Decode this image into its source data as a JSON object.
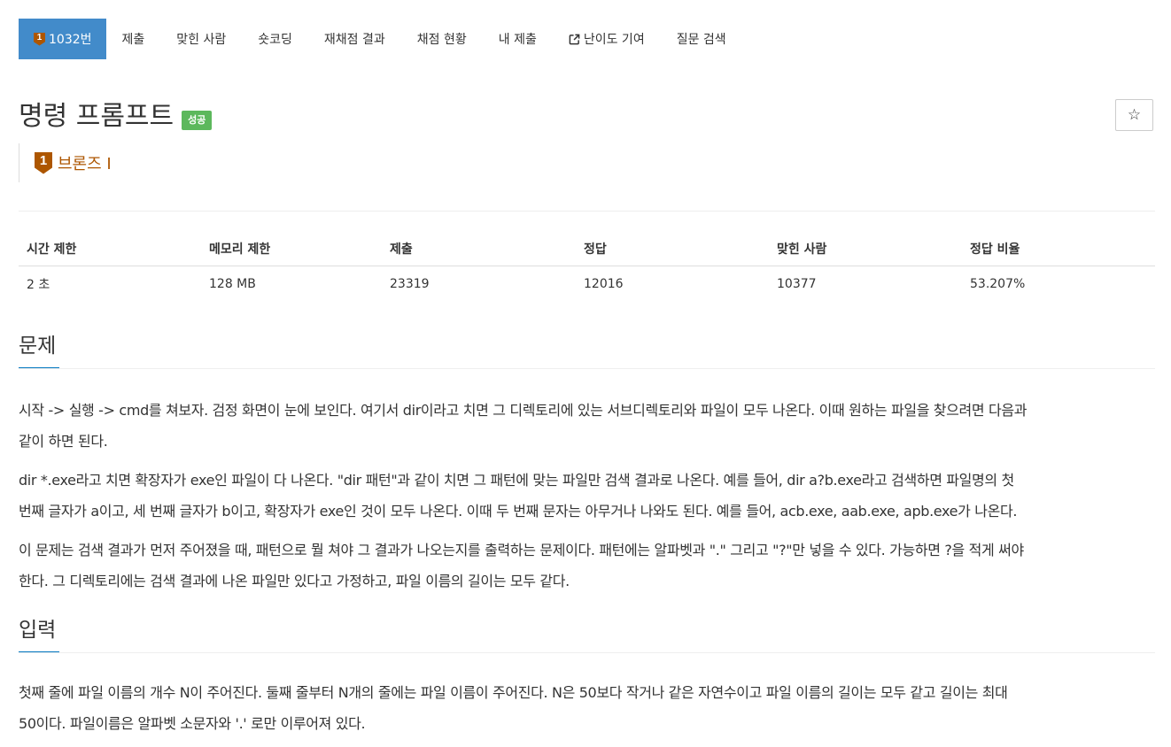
{
  "nav": {
    "tabs": [
      {
        "label": "1032번",
        "tier_number": "1",
        "active": true
      },
      {
        "label": "제출"
      },
      {
        "label": "맞힌 사람"
      },
      {
        "label": "숏코딩"
      },
      {
        "label": "재채점 결과"
      },
      {
        "label": "채점 현황"
      },
      {
        "label": "내 제출"
      },
      {
        "label": "난이도 기여",
        "icon": "external-link-icon"
      },
      {
        "label": "질문 검색"
      }
    ]
  },
  "problem": {
    "title": "명령 프롬프트",
    "result_badge": "성공",
    "star_icon": "☆",
    "tier": {
      "number": "1",
      "label": "브론즈 I",
      "color": "#ad5600"
    }
  },
  "info_table": {
    "headers": [
      "시간 제한",
      "메모리 제한",
      "제출",
      "정답",
      "맞힌 사람",
      "정답 비율"
    ],
    "values": [
      "2 초",
      "128 MB",
      "23319",
      "12016",
      "10377",
      "53.207%"
    ]
  },
  "sections": {
    "description": {
      "heading": "문제",
      "lines": [
        "시작 -> 실행 -> cmd를 쳐보자. 검정 화면이 눈에 보인다. 여기서 dir이라고 치면 그 디렉토리에 있는 서브디렉토리와 파일이 모두 나온다. 이때 원하는 파일을 찾으려면 다음과",
        "같이 하면 된다.",
        "dir *.exe라고 치면 확장자가 exe인 파일이 다 나온다. \"dir 패턴\"과 같이 치면 그 패턴에 맞는 파일만 검색 결과로 나온다. 예를 들어, dir a?b.exe라고 검색하면 파일명의 첫",
        "번째 글자가 a이고, 세 번째 글자가 b이고, 확장자가 exe인 것이 모두 나온다. 이때 두 번째 문자는 아무거나 나와도 된다. 예를 들어, acb.exe, aab.exe, apb.exe가 나온다.",
        "이 문제는 검색 결과가 먼저 주어졌을 때, 패턴으로 뭘 쳐야 그 결과가 나오는지를 출력하는 문제이다. 패턴에는 알파벳과 \".\" 그리고 \"?\"만 넣을 수 있다. 가능하면 ?을 적게 써야",
        "한다. 그 디렉토리에는 검색 결과에 나온 파일만 있다고 가정하고, 파일 이름의 길이는 모두 같다."
      ]
    },
    "input": {
      "heading": "입력",
      "lines": [
        "첫째 줄에 파일 이름의 개수 N이 주어진다. 둘째 줄부터 N개의 줄에는 파일 이름이 주어진다. N은 50보다 작거나 같은 자연수이고 파일 이름의 길이는 모두 같고 길이는 최대",
        "50이다. 파일이름은 알파벳 소문자와 '.' 로만 이루어져 있다."
      ]
    }
  },
  "colors": {
    "active_tab": "#428bca",
    "success": "#5cb85c",
    "bronze": "#ad5600",
    "heading_accent": "#0076c0"
  }
}
